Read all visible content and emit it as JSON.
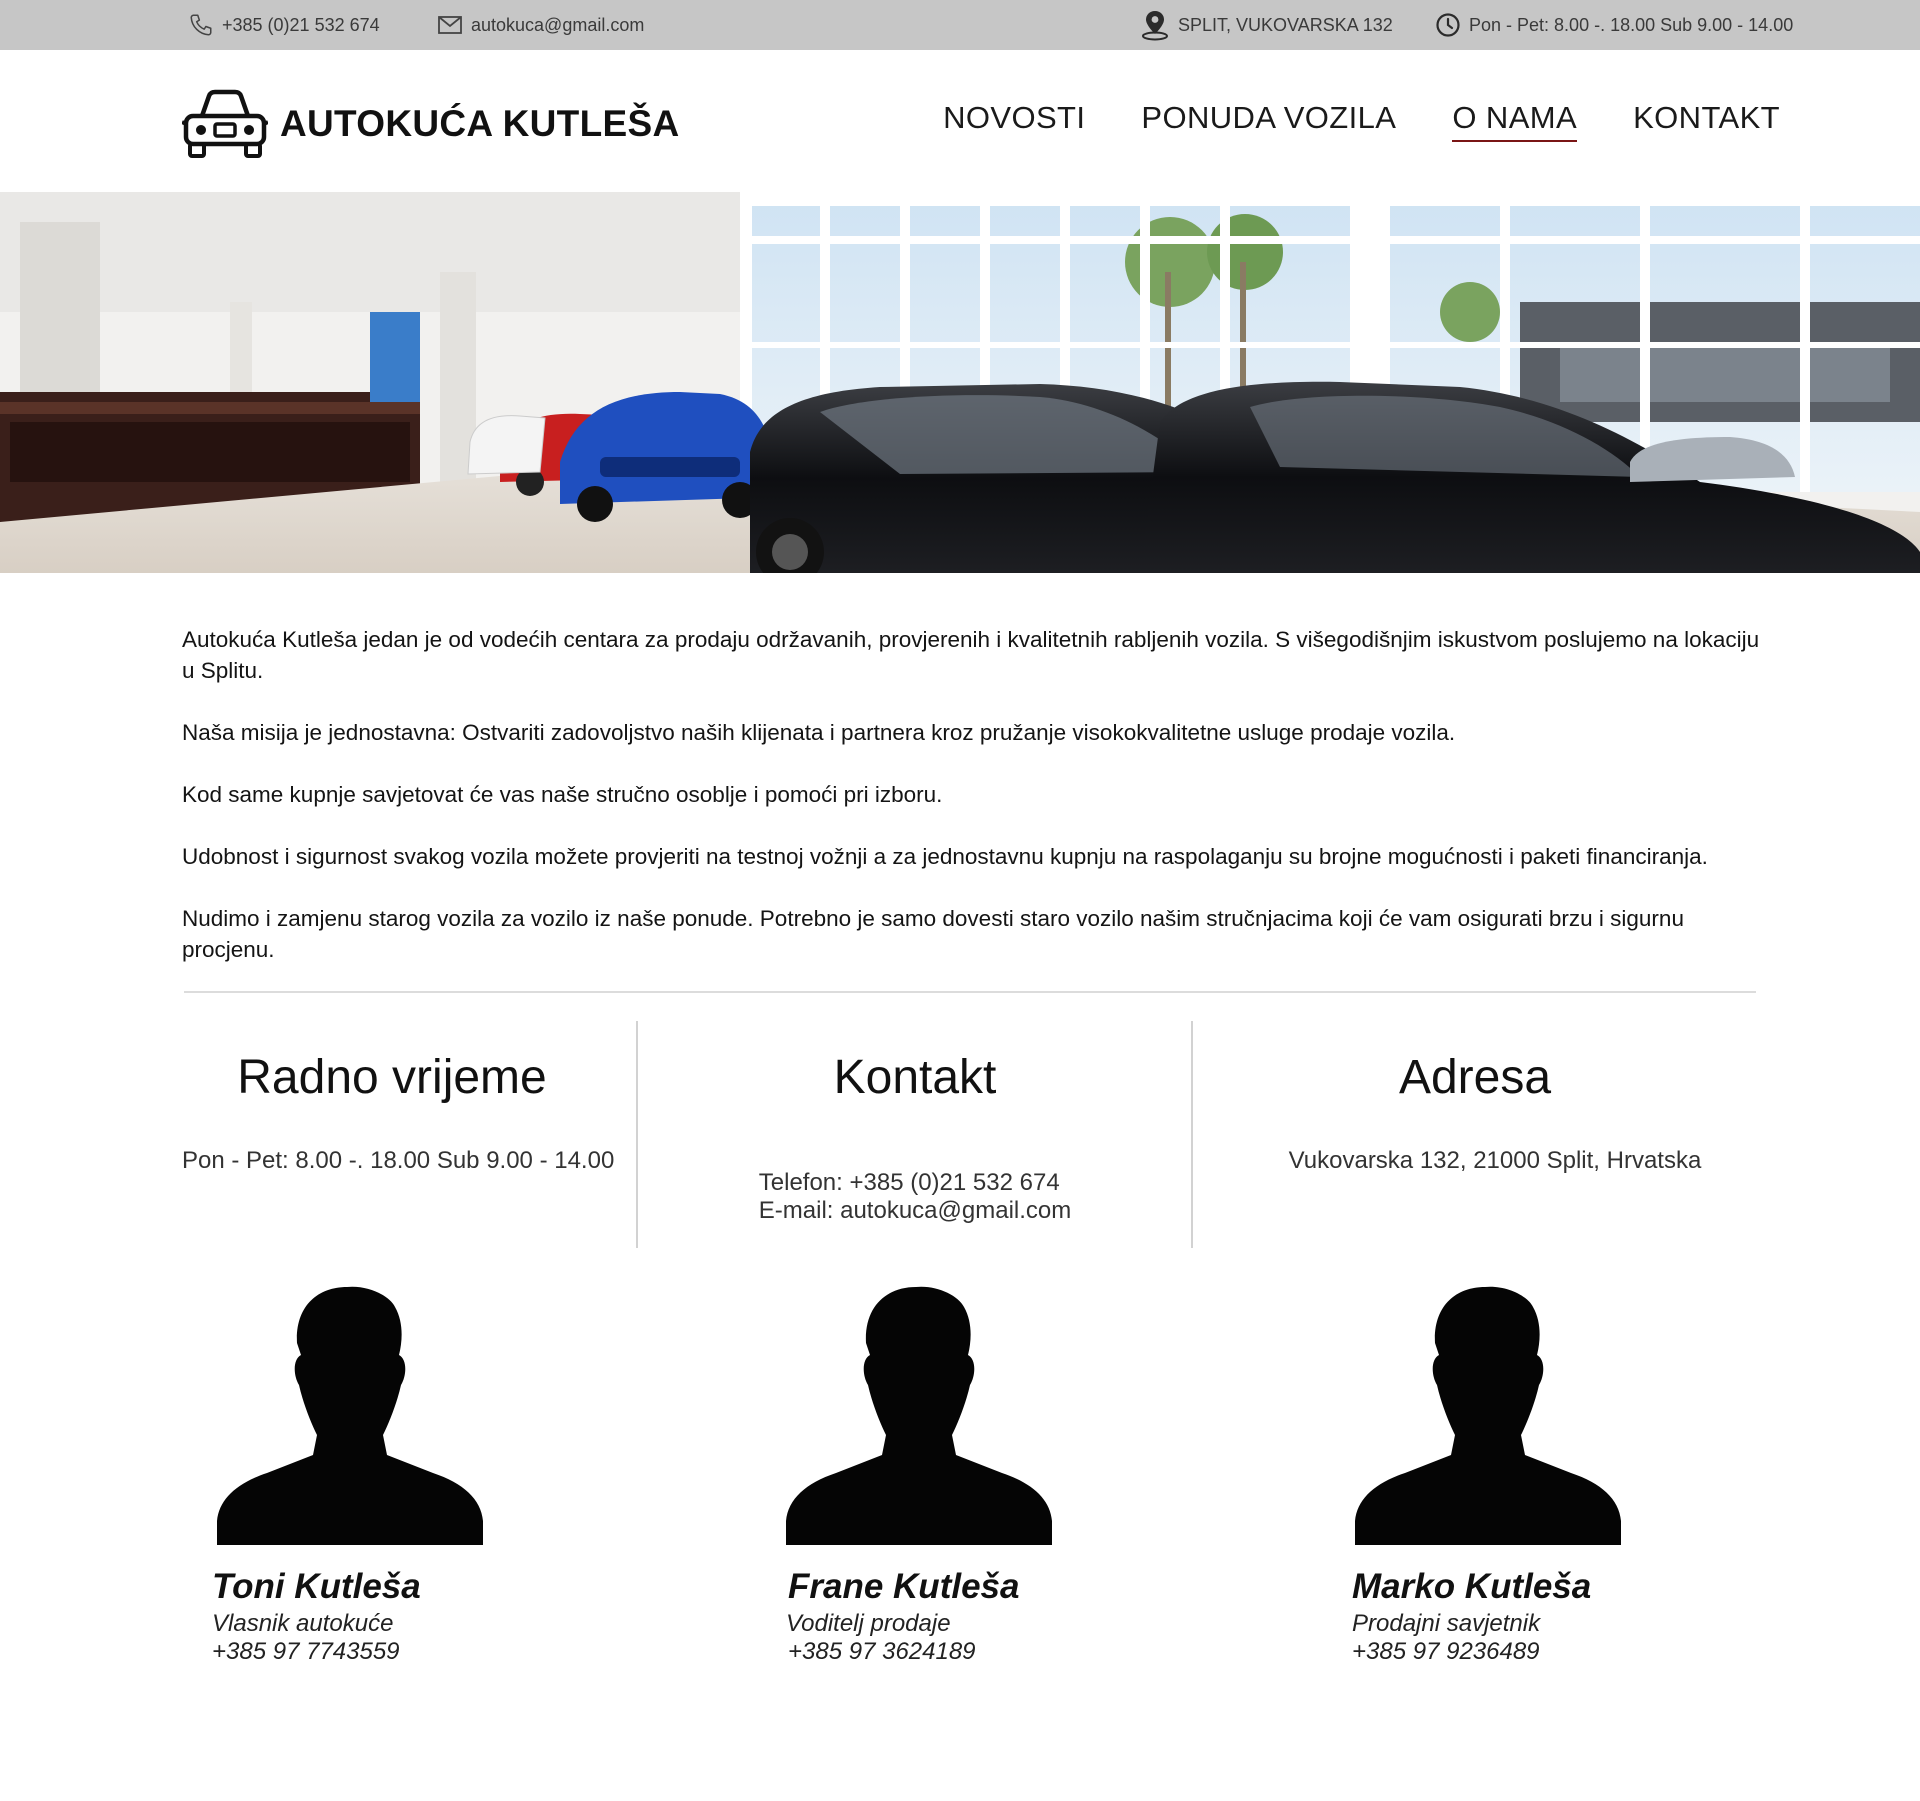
{
  "topbar": {
    "phone": "+385 (0)21 532 674",
    "email": "autokuca@gmail.com",
    "location": "SPLIT, VUKOVARSKA 132",
    "hours": "Pon - Pet: 8.00 -. 18.00 Sub 9.00 - 14.00",
    "icons": [
      "phone-icon",
      "mail-icon",
      "map-pin-icon",
      "clock-icon"
    ]
  },
  "header": {
    "logo_text": "AUTOKUĆA KUTLEŠA",
    "logo_icon": "car-icon",
    "nav": [
      {
        "label": "NOVOSTI"
      },
      {
        "label": "PONUDA VOZILA"
      },
      {
        "label": "O NAMA",
        "active": true
      },
      {
        "label": "KONTAKT"
      }
    ],
    "accent_color": "#7a1515"
  },
  "intro": {
    "paragraphs": [
      "Autokuća Kutleša jedan je od vodećih centara za prodaju održavanih, provjerenih i kvalitetnih rabljenih vozila. S višegodišnjim iskustvom poslujemo na lokaciju u Splitu.",
      "Naša misija je jednostavna: Ostvariti zadovoljstvo naših klijenata i partnera kroz pružanje visokokvalitetne usluge prodaje vozila.",
      "Kod same kupnje savjetovat će vas naše stručno osoblje i pomoći pri izboru.",
      "Udobnost i sigurnost svakog vozila možete provjeriti na testnoj vožnji a za jednostavnu kupnju na raspolaganju su brojne mogućnosti i paketi financiranja.",
      "Nudimo i zamjenu starog vozila za vozilo iz naše ponude. Potrebno je samo dovesti staro vozilo našim stručnjacima koji će vam osigurati brzu i sigurnu procjenu."
    ]
  },
  "info": {
    "hours": {
      "title": "Radno vrijeme",
      "text": "Pon - Pet: 8.00 -. 18.00 Sub 9.00 - 14.00"
    },
    "contact": {
      "title": "Kontakt",
      "phone": "Telefon: +385 (0)21 532 674",
      "email": "E-mail: autokuca@gmail.com"
    },
    "address": {
      "title": "Adresa",
      "text": "Vukovarska 132, 21000 Split, Hrvatska"
    }
  },
  "team": [
    {
      "name": "Toni Kutleša",
      "role": "Vlasnik autokuće",
      "phone": "+385 97 7743559"
    },
    {
      "name": "Frane Kutleša",
      "role": "Voditelj prodaje",
      "phone": "+385 97 3624189"
    },
    {
      "name": "Marko Kutleša",
      "role": "Prodajni savjetnik",
      "phone": "+385 97 9236489"
    }
  ]
}
